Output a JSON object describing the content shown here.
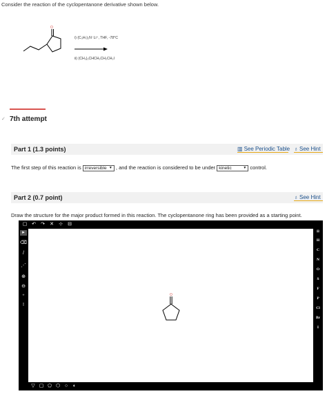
{
  "question": "Consider the reaction of the cyclopentanone derivative shown below.",
  "scheme": {
    "reagent1": "i) (C₃H₇)₂N⁻Li⁺, THF, -78°C",
    "reagent2": "ii) (CH₃)₂CHCH₂CH₂CH₂I",
    "carbonyl_label": "O"
  },
  "attempt": "7th attempt",
  "attempt_check": "✓",
  "part1": {
    "title": "Part 1   (1.3 points)",
    "periodic_table": "See Periodic Table",
    "hint": "See Hint",
    "sentence_a": "The first step of this reaction is",
    "dropdown1": "irreversible",
    "sentence_b": ", and the reaction is considered to be under",
    "dropdown2": "kinetic",
    "sentence_c": "control."
  },
  "part2": {
    "title": "Part 2   (0.7 point)",
    "hint": "See Hint",
    "instruction": "Draw the structure for the major product formed in this reaction. The cyclopentanone ring has been provided as a starting point."
  },
  "editor": {
    "elements": [
      "H",
      "C",
      "N",
      "O",
      "S",
      "F",
      "P",
      "Cl",
      "Br",
      "I"
    ],
    "carbonyl_label": "O",
    "top_tools": [
      "▢",
      "↶",
      "↷",
      "✕",
      "⊹",
      "⊟"
    ],
    "left_tools": [
      "▸",
      "⌫",
      "/",
      "⋰",
      "⊕",
      "⊖",
      "⁺",
      "↕"
    ],
    "bottom_tools": [
      "▽",
      "▢",
      "⬠",
      "⬡",
      "○",
      "◐"
    ],
    "expand": "⊞"
  },
  "colors": {
    "link": "#1a4f8b",
    "hint_underline": "#e6a817",
    "attempt_bar": "#d9534f",
    "header_bg": "#f1f1f1"
  }
}
